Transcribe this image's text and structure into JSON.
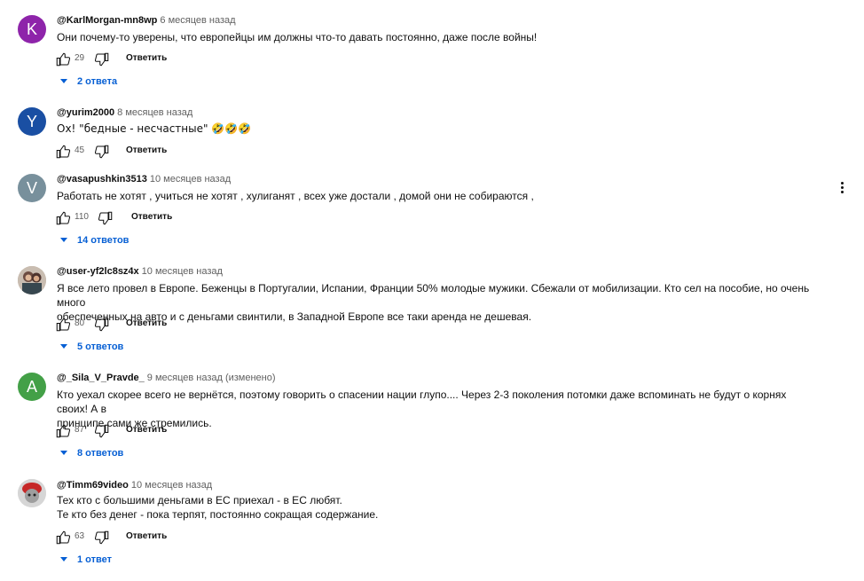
{
  "comments": [
    {
      "avatar_letter": "K",
      "avatar_color": "#8e24aa",
      "author": "@KarlMorgan-mn8wp",
      "time": "6 месяцев назад",
      "text": "Они почему-то уверены, что европейцы им должны что-то давать постоянно, даже после войны!",
      "likes": "29",
      "reply_label": "Ответить",
      "replies_label": "2 ответа"
    },
    {
      "avatar_letter": "Y",
      "avatar_color": "#1a4fa3",
      "author": "@yurim2000",
      "time": "8 месяцев назад",
      "text": "Ох! \"бедные - несчастные\" 🤣🤣🤣",
      "likes": "45",
      "reply_label": "Ответить"
    },
    {
      "avatar_letter": "V",
      "avatar_color": "#78909c",
      "author": "@vasapushkin3513",
      "time": "10 месяцев назад",
      "text": "Работать не хотят , учиться не хотят , хулиганят , всех уже достали , домой они не собираются ,",
      "likes": "110",
      "reply_label": "Ответить",
      "replies_label": "14 ответов"
    },
    {
      "avatar_letter": "",
      "author": "@user-yf2lc8sz4x",
      "time": "10 месяцев назад",
      "text": "Я все лето провел в Европе. Беженцы в Португалии, Испании, Франции 50% молодые мужики. Сбежали от мобилизации. Кто сел на пособие, но очень много\nобеспеченных на авто и с деньгами свинтили, в Западной Европе все таки аренда не дешевая.",
      "likes": "80",
      "reply_label": "Ответить",
      "replies_label": "5 ответов"
    },
    {
      "avatar_letter": "A",
      "avatar_color": "#43a047",
      "author": "@_Sila_V_Pravde_",
      "time": "9 месяцев назад",
      "edited": "(изменено)",
      "text": "Кто уехал скорее всего не вернётся, поэтому говорить о спасении нации глупо.... Через 2-3 поколения потомки даже вспоминать не будут о корнях своих! А в\nпринципе сами же стремились.",
      "likes": "87",
      "reply_label": "Ответить",
      "replies_label": "8 ответов"
    },
    {
      "avatar_letter": "",
      "author": "@Timm69video",
      "time": "10 месяцев назад",
      "text": "Тех кто с большими деньгами в ЕС приехал - в ЕС  любят.\nТе кто без денег - пока терпят, постоянно сокращая содержание.",
      "likes": "63",
      "reply_label": "Ответить",
      "replies_label": "1 ответ"
    }
  ]
}
